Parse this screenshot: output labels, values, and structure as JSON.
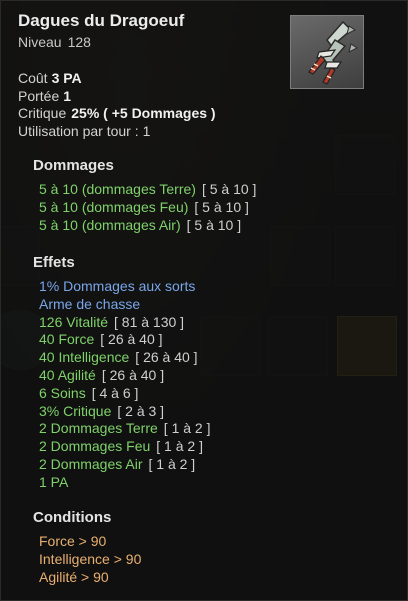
{
  "item": {
    "name": "Dagues du Dragoeuf",
    "level_label": "Niveau",
    "level_value": "128",
    "image_icon": "dragoeuf-daggers-icon"
  },
  "stats": {
    "cost_label": "Coût",
    "cost_value": "3 PA",
    "range_label": "Portée",
    "range_value": "1",
    "crit_label": "Critique",
    "crit_value": "25% ( +5 Dommages )",
    "uses_label": "Utilisation par tour :",
    "uses_value": "1"
  },
  "damage": {
    "title": "Dommages",
    "lines": [
      {
        "text": "5 à 10 (dommages Terre)",
        "range": "[ 5 à 10 ]"
      },
      {
        "text": "5 à 10 (dommages Feu)",
        "range": "[ 5 à 10 ]"
      },
      {
        "text": "5 à 10 (dommages Air)",
        "range": "[ 5 à 10 ]"
      }
    ]
  },
  "effects": {
    "title": "Effets",
    "special": [
      "1% Dommages aux sorts",
      "Arme de chasse"
    ],
    "lines": [
      {
        "text": "126 Vitalité",
        "range": "[ 81 à 130 ]"
      },
      {
        "text": "40 Force",
        "range": "[ 26 à 40 ]"
      },
      {
        "text": "40 Intelligence",
        "range": "[ 26 à 40 ]"
      },
      {
        "text": "40 Agilité",
        "range": "[ 26 à 40 ]"
      },
      {
        "text": "6 Soins",
        "range": "[ 4 à 6 ]"
      },
      {
        "text": "3% Critique",
        "range": "[ 2 à 3 ]"
      },
      {
        "text": "2 Dommages Terre",
        "range": "[ 1 à 2 ]"
      },
      {
        "text": "2 Dommages Feu",
        "range": "[ 1 à 2 ]"
      },
      {
        "text": "2 Dommages Air",
        "range": "[ 1 à 2 ]"
      },
      {
        "text": "1 PA",
        "range": ""
      }
    ]
  },
  "conditions": {
    "title": "Conditions",
    "lines": [
      "Force > 90",
      "Intelligence > 90",
      "Agilité > 90"
    ]
  },
  "colors": {
    "effect_green": "#7fd26a",
    "special_blue": "#79a6e8",
    "condition_orange": "#e8b070"
  }
}
